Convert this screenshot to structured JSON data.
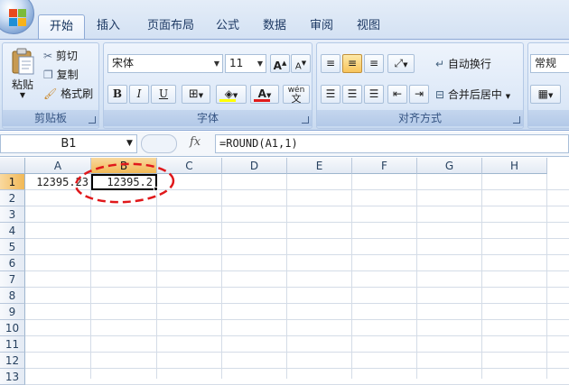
{
  "tabs": [
    "开始",
    "插入",
    "页面布局",
    "公式",
    "数据",
    "审阅",
    "视图"
  ],
  "clipboard": {
    "paste": "粘贴",
    "cut": "剪切",
    "copy": "复制",
    "format_painter": "格式刷",
    "group_label": "剪贴板"
  },
  "font": {
    "name": "宋体",
    "size": "11",
    "bold": "B",
    "italic": "I",
    "underline": "U",
    "grow": "A",
    "shrink": "A",
    "font_color_letter": "A",
    "phonetic": "wén",
    "group_label": "字体"
  },
  "alignment": {
    "wrap_text": "自动换行",
    "merge_center": "合并后居中",
    "group_label": "对齐方式"
  },
  "number": {
    "format": "常规"
  },
  "formula_bar": {
    "name_box": "B1",
    "fx": "fx",
    "formula": "=ROUND(A1,1)"
  },
  "columns": [
    "A",
    "B",
    "C",
    "D",
    "E",
    "F",
    "G",
    "H"
  ],
  "rows": [
    "1",
    "2",
    "3",
    "4",
    "5",
    "6",
    "7",
    "8",
    "9",
    "10",
    "11",
    "12",
    "13"
  ],
  "cells": {
    "A1": "12395.23",
    "B1": "12395.2"
  },
  "colors": {
    "accent_selected": "#f1b856",
    "annotation": "#e0181b",
    "font_color_bar": "#e01b1b",
    "highlight_bar": "#ffff00"
  }
}
